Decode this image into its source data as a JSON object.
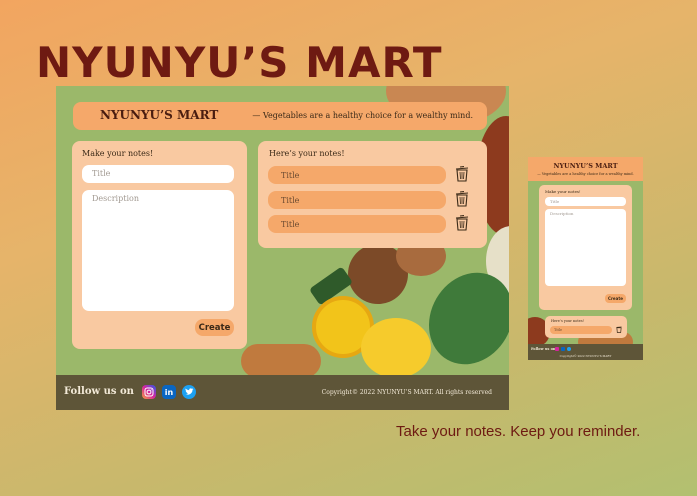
{
  "brand": "NYUNYU’S MART",
  "tagline_bottom": "Take your notes. Keep you reminder.",
  "header": {
    "brand": "NYUNYU’S MART",
    "motto": "— Vegetables are a healthy choice for a wealthy mind."
  },
  "form": {
    "heading": "Make your notes!",
    "title_placeholder": "Title",
    "description_placeholder": "Description",
    "create_label": "Create"
  },
  "notes": {
    "heading": "Here’s your notes!",
    "items": [
      {
        "title": "Title"
      },
      {
        "title": "Title"
      },
      {
        "title": "Title"
      }
    ]
  },
  "footer": {
    "follow_label": "Follow us on",
    "socials": [
      "instagram-icon",
      "linkedin-icon",
      "twitter-icon"
    ],
    "copyright": "Copyright© 2022 NYUNYU’S MART. All rights reserved"
  },
  "mobile": {
    "brand": "NYUNYU’S MART",
    "motto": "— Vegetables are a healthy choice for a wealthy mind.",
    "form_heading": "Make your notes!",
    "title_placeholder": "Title",
    "description_placeholder": "Description",
    "create_label": "Create",
    "notes_heading": "Here’s your notes!",
    "note_title": "Title",
    "follow_label": "Follow us on",
    "copyright": "Copyright© 2022 NYUNYU’S MART"
  },
  "colors": {
    "brand_text": "#6e1a12",
    "accent_orange": "#f5a86a",
    "card_peach": "#f9c9a1",
    "background_green": "#9bb86a",
    "footer_brown": "#5e5538"
  }
}
